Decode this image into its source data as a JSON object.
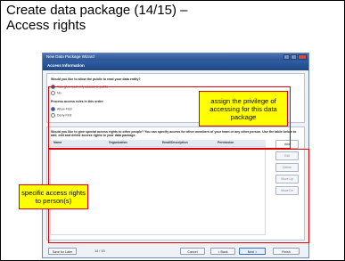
{
  "slide": {
    "title_line1": "Create data package (14/15) –",
    "title_line2": "Access rights"
  },
  "dialog": {
    "window_title": "New Data Package Wizard",
    "header": "Access Information",
    "public_question": "Would you like to allow the public to read your data entity?",
    "public_options": [
      "Yes, give read-only access to public",
      "No"
    ],
    "order_label": "Process access rules in this order:",
    "order_options": [
      "Allow First",
      "Deny First"
    ],
    "special_question": "Would you like to give special access rights to other people? You can specify access for other members of your team or any other person. Use the table below to add, edit and delete access rights to your data package.",
    "columns": [
      "Name",
      "Organization",
      "Email/Description",
      "Permission"
    ],
    "side_buttons": [
      "Add",
      "Edit",
      "Delete",
      "Move Up",
      "Move Dn"
    ],
    "footer": {
      "save_later": "Save for Later",
      "step": "14 / 15",
      "cancel": "Cancel",
      "back": "< Back",
      "next": "Next >",
      "finish": "Finish"
    }
  },
  "annotations": {
    "top": "assign the privilege of accessing for this data package",
    "bottom": "specific access rights to person(s)",
    "color_border": "#e00000",
    "color_fill": "#ffff00"
  }
}
